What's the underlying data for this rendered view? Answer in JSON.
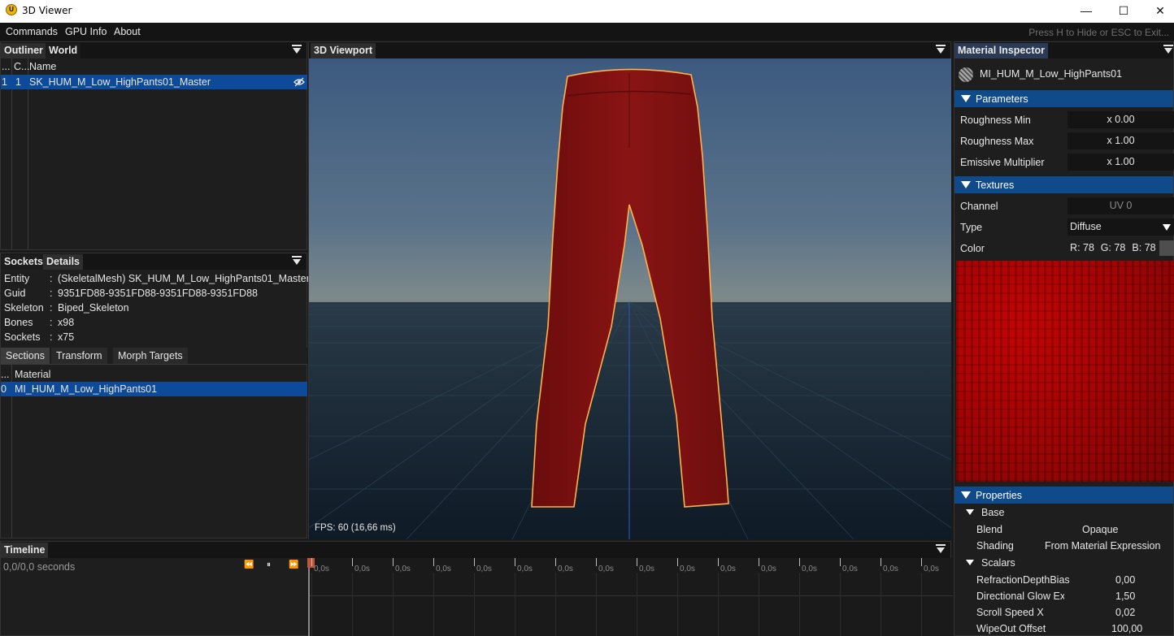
{
  "window": {
    "title": "3D Viewer",
    "app_icon": "unreal-logo-icon",
    "minimize": "—",
    "maximize": "☐",
    "close": "✕"
  },
  "menubar": {
    "items": [
      "Commands",
      "GPU Info",
      "About"
    ],
    "hint": "Press H to Hide or ESC to Exit..."
  },
  "outliner": {
    "tabs": [
      "Outliner",
      "World"
    ],
    "columns": [
      "...",
      "C...",
      "Name"
    ],
    "rows": [
      {
        "idx": "1",
        "count": "1",
        "name": "SK_HUM_M_Low_HighPants01_Master",
        "icon": "visibility-off-icon"
      }
    ]
  },
  "details": {
    "tabs": [
      "Sockets",
      "Details"
    ],
    "fields": [
      {
        "key": "Entity",
        "sep": ":",
        "value": "(SkeletalMesh) SK_HUM_M_Low_HighPants01_Master"
      },
      {
        "key": "Guid",
        "sep": ":",
        "value": "9351FD88-9351FD88-9351FD88-9351FD88"
      },
      {
        "key": "Skeleton",
        "sep": ":",
        "value": "Biped_Skeleton"
      },
      {
        "key": "Bones",
        "sep": ":",
        "value": "x98"
      },
      {
        "key": "Sockets",
        "sep": ":",
        "value": "x75"
      }
    ],
    "subtabs": [
      "Sections",
      "Transform",
      "Morph Targets"
    ],
    "sections_columns": [
      "...",
      "Material"
    ],
    "sections_rows": [
      {
        "idx": "0",
        "material": "MI_HUM_M_Low_HighPants01"
      }
    ]
  },
  "viewport": {
    "tab": "3D Viewport",
    "fps": "FPS: 60 (16,66 ms)"
  },
  "timeline": {
    "tab": "Timeline",
    "time": "0,0/0,0 seconds",
    "controls": [
      "⏪",
      "⏸",
      "⏩"
    ],
    "tick_label": "0,0s",
    "tick_count": 16
  },
  "inspector": {
    "tab": "Material Inspector",
    "material_name": "MI_HUM_M_Low_HighPants01",
    "parameters_label": "Parameters",
    "parameters": [
      {
        "label": "Roughness Min",
        "value": "x 0.00"
      },
      {
        "label": "Roughness Max",
        "value": "x 1.00"
      },
      {
        "label": "Emissive Multiplier",
        "value": "x 1.00"
      }
    ],
    "textures_label": "Textures",
    "channel_label": "Channel",
    "channel_value": "UV 0",
    "type_label": "Type",
    "type_value": "Diffuse",
    "color_label": "Color",
    "color_r": "R: 78",
    "color_g": "G: 78",
    "color_b": "B: 78",
    "properties_label": "Properties",
    "base_label": "Base",
    "blend_label": "Blend",
    "blend_value": "Opaque",
    "shading_label": "Shading",
    "shading_value": "From Material Expression",
    "scalars_label": "Scalars",
    "scalars": [
      {
        "label": "RefractionDepthBias",
        "value": "0,00"
      },
      {
        "label": "Directional Glow Exp (S",
        "value": "1,50"
      },
      {
        "label": "Scroll Speed X",
        "value": "0,02"
      },
      {
        "label": "WipeOut Offset",
        "value": "100,00"
      }
    ]
  },
  "colors": {
    "selection": "#0e4a9a",
    "section_header": "#0f4a8a",
    "pants": "#7a1010",
    "outline": "#ffb24a",
    "texture": "#a00000"
  }
}
